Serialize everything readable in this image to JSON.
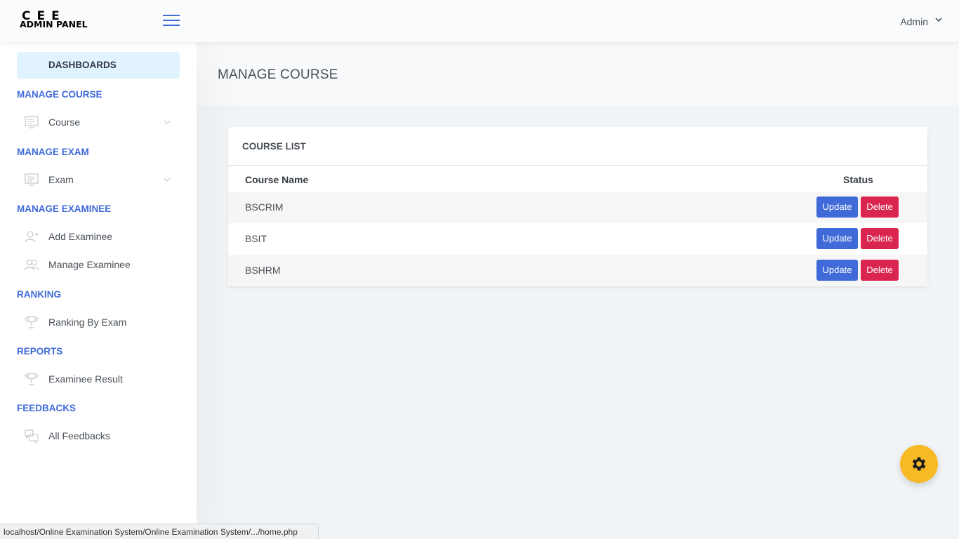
{
  "header": {
    "logo_top": "CEE",
    "logo_bottom": "ADMIN PANEL",
    "user": "Admin"
  },
  "sidebar": {
    "dashboard": "DASHBOARDS",
    "sections": [
      {
        "title": "MANAGE COURSE",
        "items": [
          {
            "label": "Course",
            "icon": "monitor-icon",
            "expandable": true
          }
        ]
      },
      {
        "title": "MANAGE EXAM",
        "items": [
          {
            "label": "Exam",
            "icon": "monitor-icon",
            "expandable": true
          }
        ]
      },
      {
        "title": "MANAGE EXAMINEE",
        "items": [
          {
            "label": "Add Examinee",
            "icon": "add-user-icon"
          },
          {
            "label": "Manage Examinee",
            "icon": "users-icon"
          }
        ]
      },
      {
        "title": "RANKING",
        "items": [
          {
            "label": "Ranking By Exam",
            "icon": "trophy-icon"
          }
        ]
      },
      {
        "title": "REPORTS",
        "items": [
          {
            "label": "Examinee Result",
            "icon": "trophy-icon"
          }
        ]
      },
      {
        "title": "FEEDBACKS",
        "items": [
          {
            "label": "All Feedbacks",
            "icon": "chat-icon"
          }
        ]
      }
    ]
  },
  "page": {
    "title": "MANAGE COURSE"
  },
  "card": {
    "title": "COURSE LIST",
    "columns": [
      "Course Name",
      "Status"
    ],
    "rows": [
      {
        "name": "BSCRIM"
      },
      {
        "name": "BSIT"
      },
      {
        "name": "BSHRM"
      }
    ],
    "update_label": "Update",
    "delete_label": "Delete"
  },
  "statusbar": {
    "url": "localhost/Online Examination System/Online Examination System/.../home.php"
  },
  "colors": {
    "primary": "#3f6ad8",
    "danger": "#d92550",
    "warning": "#f7b924",
    "active_bg": "#e0f3ff"
  }
}
